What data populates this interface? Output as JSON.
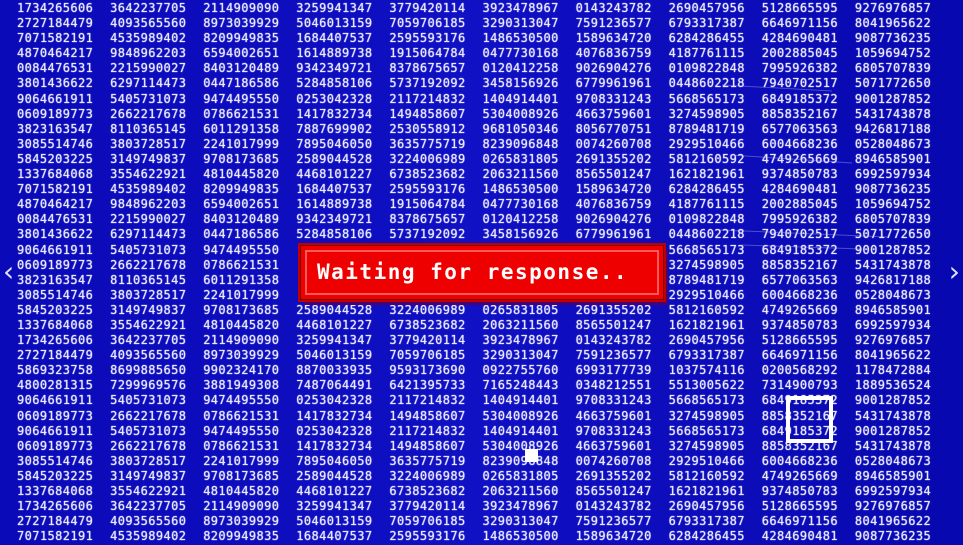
{
  "screen": {
    "background_color": "#0a0ab8",
    "text_color": "#e8e8ff",
    "rows": [
      [
        "1734265606",
        "3642237705",
        "2114909090",
        "3259941347",
        "3779420114",
        "3923478967",
        "0143243782",
        "2690457956",
        "5128665595",
        "9276976857"
      ],
      [
        "2727184479",
        "4093565560",
        "8973039929",
        "5046013159",
        "7059706185",
        "3290313047",
        "7591236577",
        "6793317387",
        "6646971156",
        "8041965622"
      ],
      [
        "7071582191",
        "4535989402",
        "8209949835",
        "1684407537",
        "2595593176",
        "1486530500",
        "1589634720",
        "6284286455",
        "4284690481",
        "9087736235"
      ],
      [
        "4870464217",
        "9848962203",
        "6594002651",
        "1614889738",
        "1915064784",
        "0477730168",
        "4076836759",
        "4187761115",
        "2002885045",
        "1059694752"
      ],
      [
        "0084476531",
        "2215990027",
        "8403120489",
        "9342349721",
        "8378675657",
        "0120412258",
        "9026904276",
        "0109822848",
        "7995926382",
        "6805707839"
      ],
      [
        "3801436622",
        "6297114473",
        "0447186586",
        "5284858106",
        "5737192092",
        "3458156926",
        "6779961961",
        "0448602218",
        "7940702517",
        "5071772650"
      ],
      [
        "9064661911",
        "5405731073",
        "9474495550",
        "0253042328",
        "2117214832",
        "1404914401",
        "9708331243",
        "5668565173",
        "6849185372",
        "9001287852"
      ],
      [
        "0609189773",
        "2662217678",
        "0786621531",
        "1417832734",
        "1494858607",
        "5304008926",
        "4663759601",
        "3274598905",
        "8858352167",
        "5431743878"
      ],
      [
        "3823163547",
        "8110365145",
        "6011291358",
        "7887699902",
        "2530558912",
        "9681050346",
        "8056770751",
        "8789481719",
        "6577063563",
        "9426817188"
      ],
      [
        "3085514746",
        "3803728517",
        "2241017999",
        "7895046050",
        "3635775719",
        "8239096848",
        "0074260708",
        "2929510466",
        "6004668236",
        "0528048673"
      ],
      [
        "5845203225",
        "3149749837",
        "9708173685",
        "2589044528",
        "3224006989",
        "0265831805",
        "2691355202",
        "5812160592",
        "4749265669",
        "8946585901"
      ],
      [
        "1337684068",
        "3554622921",
        "4810445820",
        "4468101227",
        "6738523682",
        "2063211560",
        "8565501247",
        "1621821961",
        "9374850783",
        "6992597934"
      ],
      [
        "7071582191",
        "4535989402",
        "8209949835",
        "1684407537",
        "2595593176",
        "1486530500",
        "1589634720",
        "6284286455",
        "4284690481",
        "9087736235"
      ],
      [
        "4870464217",
        "9848962203",
        "6594002651",
        "1614889738",
        "1915064784",
        "0477730168",
        "4076836759",
        "4187761115",
        "2002885045",
        "1059694752"
      ],
      [
        "0084476531",
        "2215990027",
        "8403120489",
        "9342349721",
        "8378675657",
        "0120412258",
        "9026904276",
        "0109822848",
        "7995926382",
        "6805707839"
      ],
      [
        "3801436622",
        "6297114473",
        "0447186586",
        "5284858106",
        "5737192092",
        "3458156926",
        "6779961961",
        "0448602218",
        "7940702517",
        "5071772650"
      ],
      [
        "9064661911",
        "5405731073",
        "9474495550",
        "",
        "",
        "",
        "",
        "5668565173",
        "6849185372",
        "9001287852"
      ],
      [
        "0609189773",
        "2662217678",
        "0786621531",
        "",
        "",
        "",
        "",
        "3274598905",
        "8858352167",
        "5431743878"
      ],
      [
        "3823163547",
        "8110365145",
        "6011291358",
        "",
        "",
        "",
        "",
        "8789481719",
        "6577063563",
        "9426817188"
      ],
      [
        "3085514746",
        "3803728517",
        "2241017999",
        "",
        "",
        "",
        "",
        "2929510466",
        "6004668236",
        "0528048673"
      ],
      [
        "5845203225",
        "3149749837",
        "9708173685",
        "2589044528",
        "3224006989",
        "0265831805",
        "2691355202",
        "5812160592",
        "4749265669",
        "8946585901"
      ],
      [
        "1337684068",
        "3554622921",
        "4810445820",
        "4468101227",
        "6738523682",
        "2063211560",
        "8565501247",
        "1621821961",
        "9374850783",
        "6992597934"
      ],
      [
        "1734265606",
        "3642237705",
        "2114909090",
        "3259941347",
        "3779420114",
        "3923478967",
        "0143243782",
        "2690457956",
        "5128665595",
        "9276976857"
      ],
      [
        "2727184479",
        "4093565560",
        "8973039929",
        "5046013159",
        "7059706185",
        "3290313047",
        "7591236577",
        "6793317387",
        "6646971156",
        "8041965622"
      ],
      [
        "5869323758",
        "8699885650",
        "9902324170",
        "8870033935",
        "9593173690",
        "0922755760",
        "6993177739",
        "1037574116",
        "0200568292",
        "1178472884"
      ],
      [
        "4800281315",
        "7299969576",
        "3881949308",
        "7487064491",
        "6421395733",
        "7165248443",
        "0348212551",
        "5513005622",
        "7314900793",
        "1889536524"
      ],
      [
        "9064661911",
        "5405731073",
        "9474495550",
        "0253042328",
        "2117214832",
        "1404914401",
        "9708331243",
        "5668565173",
        "6849185372",
        "9001287852"
      ],
      [
        "0609189773",
        "2662217678",
        "0786621531",
        "1417832734",
        "1494858607",
        "5304008926",
        "4663759601",
        "3274598905",
        "8858352167",
        "5431743878"
      ],
      [
        "9064661911",
        "5405731073",
        "9474495550",
        "0253042328",
        "2117214832",
        "1404914401",
        "9708331243",
        "5668565173",
        "6849185372",
        "9001287852"
      ],
      [
        "0609189773",
        "2662217678",
        "0786621531",
        "1417832734",
        "1494858607",
        "5304008926",
        "4663759601",
        "3274598905",
        "8858352167",
        "5431743878"
      ],
      [
        "3085514746",
        "3803728517",
        "2241017999",
        "7895046050",
        "3635775719",
        "8239096848",
        "0074260708",
        "2929510466",
        "6004668236",
        "0528048673"
      ],
      [
        "5845203225",
        "3149749837",
        "9708173685",
        "2589044528",
        "3224006989",
        "0265831805",
        "2691355202",
        "5812160592",
        "4749265669",
        "8946585901"
      ],
      [
        "1337684068",
        "3554622921",
        "4810445820",
        "4468101227",
        "6738523682",
        "2063211560",
        "8565501247",
        "1621821961",
        "9374850783",
        "6992597934"
      ],
      [
        "1734265606",
        "3642237705",
        "2114909090",
        "3259941347",
        "3779420114",
        "3923478967",
        "0143243782",
        "2690457956",
        "5128665595",
        "9276976857"
      ],
      [
        "2727184479",
        "4093565560",
        "8973039929",
        "5046013159",
        "7059706185",
        "3290313047",
        "7591236577",
        "6793317387",
        "6646971156",
        "8041965622"
      ],
      [
        "7071582191",
        "4535989402",
        "8209949835",
        "1684407537",
        "2595593176",
        "1486530500",
        "1589634720",
        "6284286455",
        "4284690481",
        "9087736235"
      ]
    ]
  },
  "dialog": {
    "message": "Waiting for response..",
    "background_color": "#ee0000",
    "text_color": "#ffffff"
  },
  "navigation": {
    "left_icon": "chevron-left-icon",
    "left_glyph": "‹",
    "right_icon": "chevron-right-icon",
    "right_glyph": "›"
  }
}
